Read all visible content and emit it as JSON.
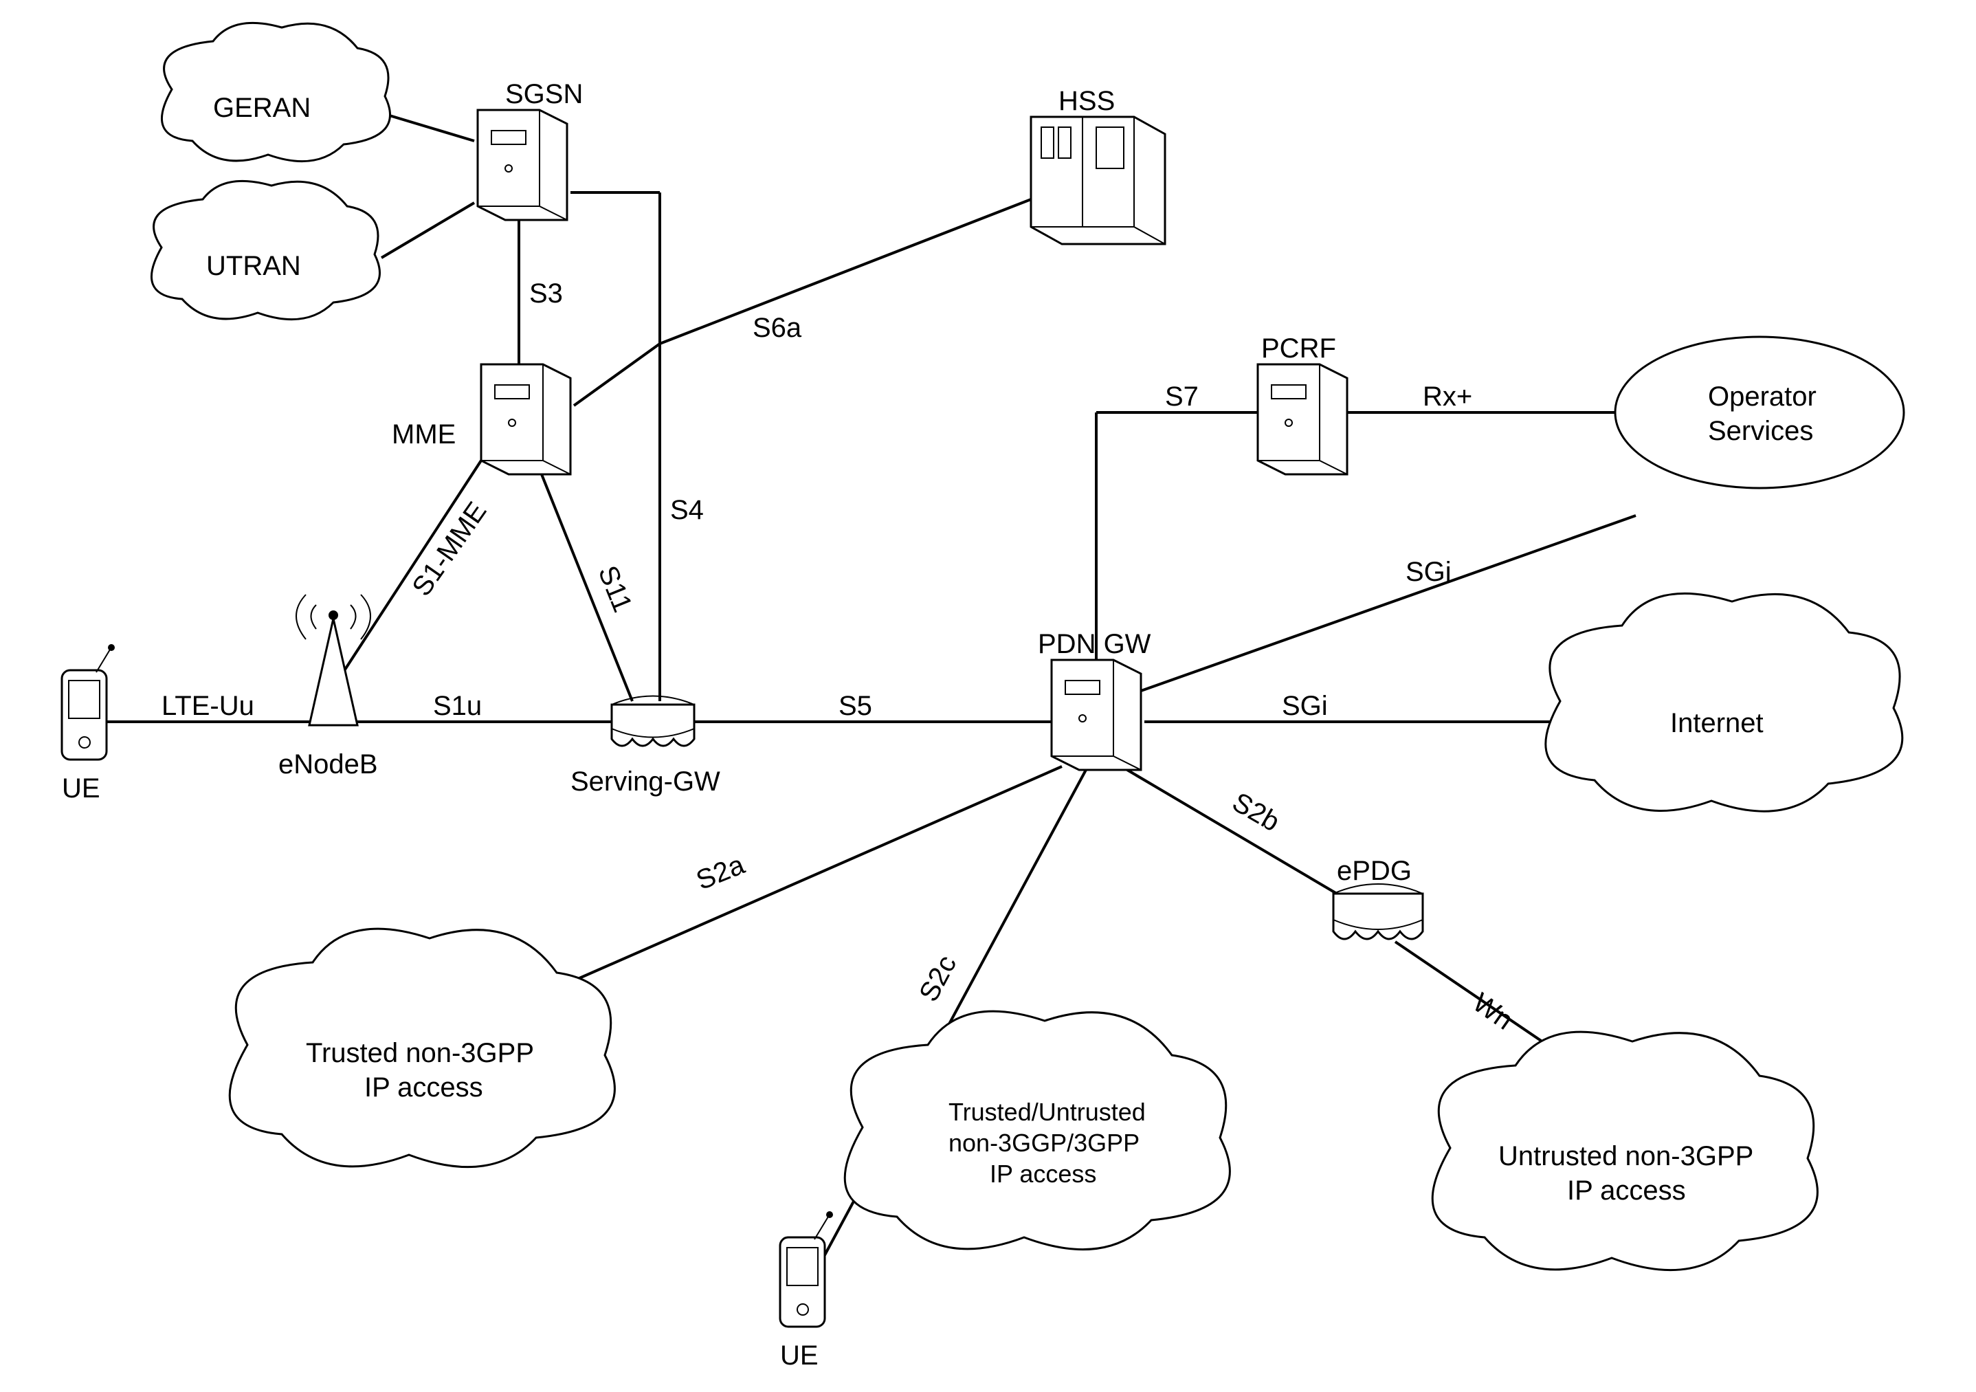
{
  "nodes": {
    "geran": {
      "label": "GERAN"
    },
    "utran": {
      "label": "UTRAN"
    },
    "sgsn": {
      "label": "SGSN"
    },
    "hss": {
      "label": "HSS"
    },
    "mme": {
      "label": "MME"
    },
    "ue1": {
      "label": "UE"
    },
    "enodeb": {
      "label": "eNodeB"
    },
    "sgw": {
      "label": "Serving-GW"
    },
    "pdngw": {
      "label": "PDN GW"
    },
    "pcrf": {
      "label": "PCRF"
    },
    "opsvc": {
      "label1": "Operator",
      "label2": "Services"
    },
    "internet": {
      "label": "Internet"
    },
    "trusted": {
      "label1": "Trusted non-3GPP",
      "label2": "IP access"
    },
    "mixed": {
      "label1": "Trusted/Untrusted",
      "label2": "non-3GGP/3GPP",
      "label3": "IP access"
    },
    "epdg": {
      "label": "ePDG"
    },
    "untrusted": {
      "label1": "Untrusted non-3GPP",
      "label2": "IP access"
    },
    "ue2": {
      "label": "UE"
    }
  },
  "links": {
    "lte_uu": "LTE-Uu",
    "s1u": "S1u",
    "s1mme": "S1-MME",
    "s11": "S11",
    "s3": "S3",
    "s4": "S4",
    "s5": "S5",
    "s6a": "S6a",
    "s7": "S7",
    "rxplus": "Rx+",
    "sgi1": "SGi",
    "sgi2": "SGi",
    "s2a": "S2a",
    "s2b": "S2b",
    "s2c": "S2c",
    "wn": "Wn"
  }
}
